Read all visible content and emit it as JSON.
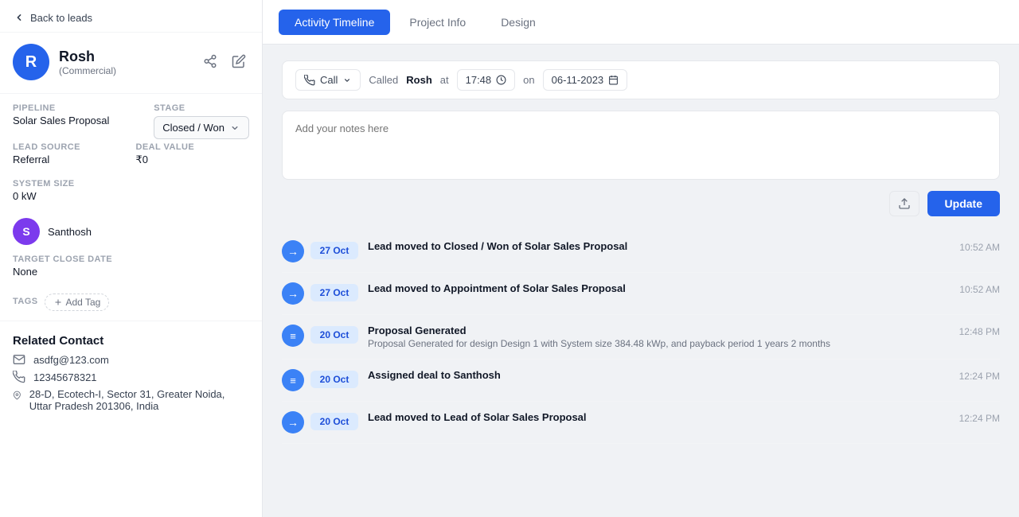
{
  "sidebar": {
    "back_label": "Back to leads",
    "avatar_initial": "R",
    "profile_name": "Rosh",
    "profile_sub": "(Commercial)",
    "pipeline_label": "Pipeline",
    "pipeline_value": "Solar Sales Proposal",
    "stage_label": "Stage",
    "stage_value": "Closed / Won",
    "lead_source_label": "Lead Source",
    "lead_source_value": "Referral",
    "deal_value_label": "Deal Value",
    "deal_value": "₹0",
    "system_size_label": "System Size",
    "system_size_value": "0 kW",
    "assignee_initial": "S",
    "assignee_name": "Santhosh",
    "target_close_label": "Target Close Date",
    "target_close_value": "None",
    "tags_label": "Tags",
    "add_tag_label": "Add Tag",
    "related_contact_label": "Related Contact",
    "contact_email": "asdfg@123.com",
    "contact_phone": "12345678321",
    "contact_address": "28-D, Ecotech-I, Sector 31, Greater Noida, Uttar Pradesh 201306, India"
  },
  "tabs": [
    {
      "id": "activity",
      "label": "Activity Timeline",
      "active": true
    },
    {
      "id": "project",
      "label": "Project Info",
      "active": false
    },
    {
      "id": "design",
      "label": "Design",
      "active": false
    }
  ],
  "call_bar": {
    "call_label": "Call",
    "called_label": "Called",
    "called_name": "Rosh",
    "at_label": "at",
    "time_value": "17:48",
    "on_label": "on",
    "date_value": "06-11-2023"
  },
  "notes": {
    "placeholder": "Add your notes here"
  },
  "update_button": "Update",
  "timeline": [
    {
      "date": "27 Oct",
      "icon_type": "arrow",
      "title": "Lead moved to Closed / Won of Solar Sales Proposal",
      "subtitle": "",
      "time": "10:52 AM"
    },
    {
      "date": "27 Oct",
      "icon_type": "arrow",
      "title": "Lead moved to Appointment of Solar Sales Proposal",
      "subtitle": "",
      "time": "10:52 AM"
    },
    {
      "date": "20 Oct",
      "icon_type": "doc",
      "title": "Proposal Generated",
      "subtitle": "Proposal Generated for design Design 1 with System size 384.48 kWp, and payback period 1 years 2 months",
      "time": "12:48 PM"
    },
    {
      "date": "20 Oct",
      "icon_type": "doc",
      "title": "Assigned deal to Santhosh",
      "subtitle": "",
      "time": "12:24 PM"
    },
    {
      "date": "20 Oct",
      "icon_type": "arrow",
      "title": "Lead moved to Lead of Solar Sales Proposal",
      "subtitle": "",
      "time": "12:24 PM"
    }
  ]
}
